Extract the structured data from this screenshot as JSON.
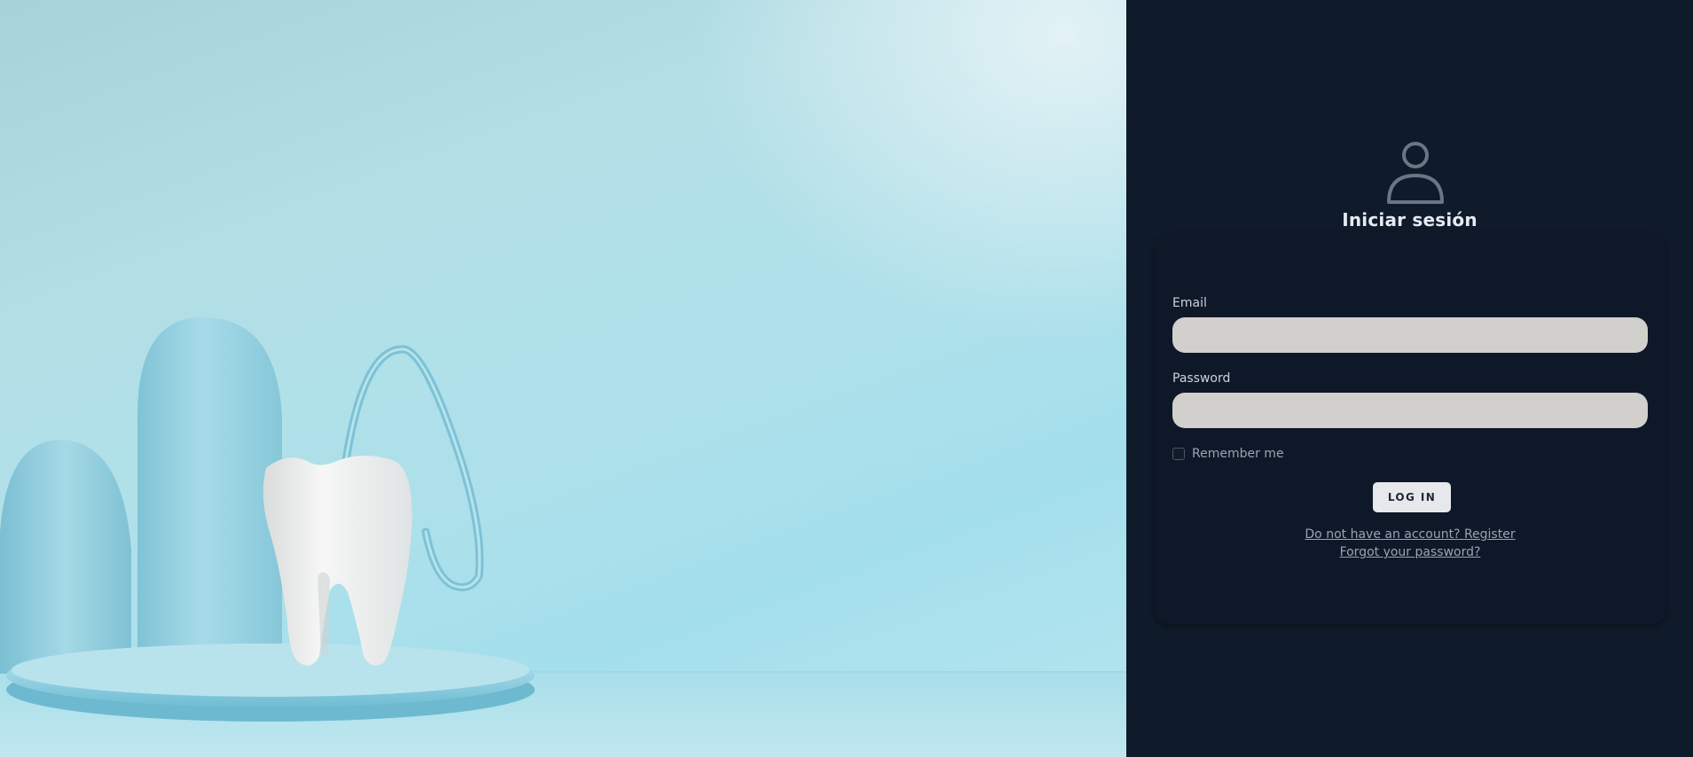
{
  "hero": {
    "image_description": "tooth-illustration"
  },
  "login": {
    "icon": "user-icon",
    "title": "Iniciar sesión",
    "email_label": "Email",
    "email_value": "",
    "password_label": "Password",
    "password_value": "",
    "remember_label": "Remember me",
    "remember_checked": false,
    "login_button": "LOG IN",
    "register_link": "Do not have an account? Register",
    "forgot_link": "Forgot your password?"
  },
  "colors": {
    "panel_bg": "#0f1a2a",
    "input_bg": "#d2d0cc",
    "button_bg": "#e6e8ec",
    "hero_bg": "#aee0ea"
  }
}
